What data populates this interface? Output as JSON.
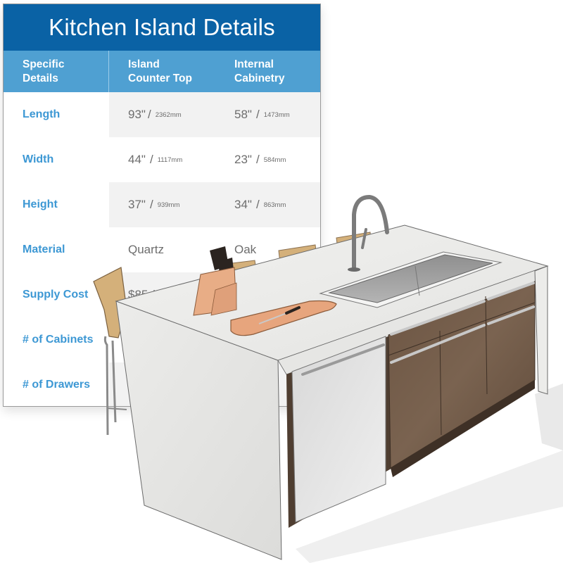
{
  "title": "Kitchen Island Details",
  "colors": {
    "title_bar": "#0a62a5",
    "header_row": "#4fa0d2",
    "label_text": "#3d98d4",
    "value_text": "#6d6d6d",
    "countertop": "#e9e9e7",
    "cabinet_wood": "#6e5744",
    "cutting_board": "#e7a57d",
    "stool_seat": "#d4b07a"
  },
  "table": {
    "headers": {
      "col1": [
        "Specific",
        "Details"
      ],
      "col2": [
        "Island",
        "Counter Top"
      ],
      "col3": [
        "Internal",
        "Cabinetry"
      ]
    },
    "rows": [
      {
        "label": "Length",
        "countertop": {
          "in": "93\"",
          "sep": "/",
          "mm": "2362mm"
        },
        "cabinetry": {
          "in": "58\"",
          "sep": "/",
          "mm": "1473mm"
        }
      },
      {
        "label": "Width",
        "countertop": {
          "in": "44\"",
          "sep": "/",
          "mm": "1117mm"
        },
        "cabinetry": {
          "in": "23\"",
          "sep": "/",
          "mm": "584mm"
        }
      },
      {
        "label": "Height",
        "countertop": {
          "in": "37\"",
          "sep": "/",
          "mm": "939mm"
        },
        "cabinetry": {
          "in": "34\"",
          "sep": "/",
          "mm": "863mm"
        }
      },
      {
        "label": "Material",
        "countertop": {
          "text": "Quartz"
        },
        "cabinetry": {
          "text": "Oak"
        }
      },
      {
        "label": "Supply Cost",
        "countertop": {
          "text": "$85 /"
        },
        "cabinetry": {
          "text": ""
        }
      },
      {
        "label": "# of Cabinets",
        "countertop": {
          "text": ""
        },
        "cabinetry": {
          "text": ""
        }
      },
      {
        "label": "# of Drawers",
        "countertop": {
          "text": ""
        },
        "cabinetry": {
          "text": ""
        }
      }
    ]
  },
  "illustration": {
    "subject": "kitchen-island-3d-model",
    "items": [
      "waterfall-quartz-countertop",
      "undermount-sink",
      "pull-down-faucet",
      "knife-block",
      "cutting-board-with-knife",
      "dishwasher",
      "oak-cabinet-drawers",
      "oak-cabinet-doors",
      "bar-stools"
    ]
  }
}
